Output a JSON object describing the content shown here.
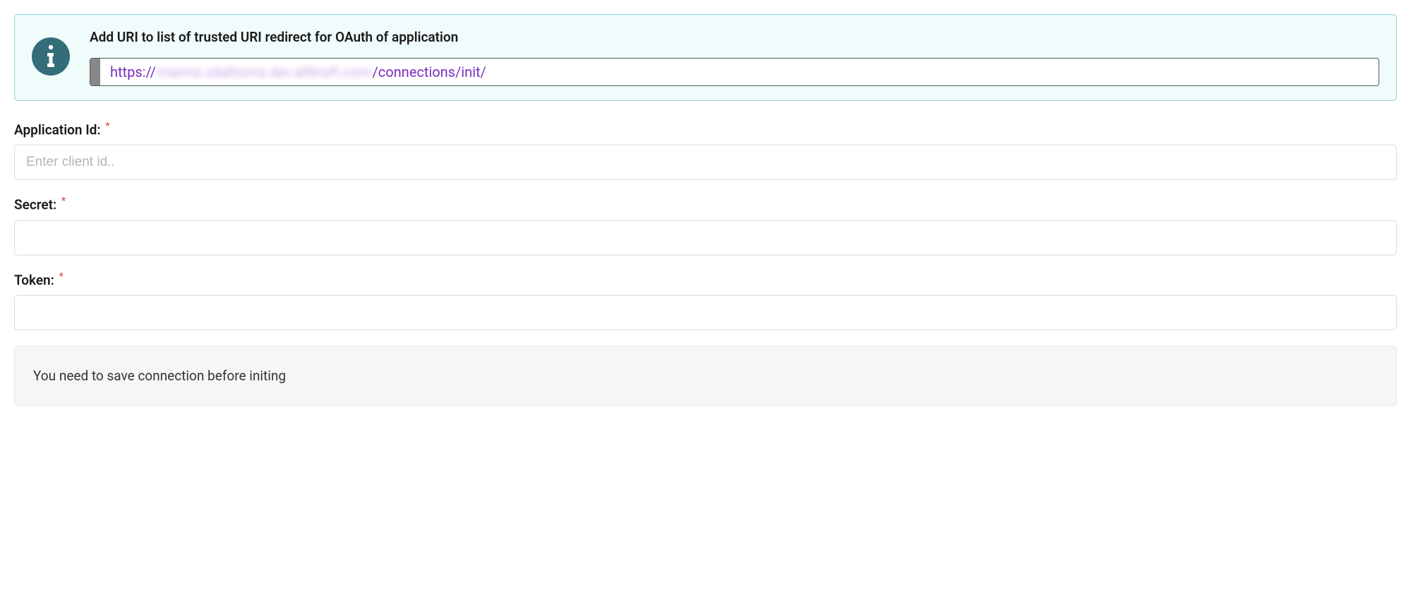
{
  "info": {
    "title": "Add URI to list of trusted URI redirect for OAuth of application",
    "uri_prefix": "https://",
    "uri_blurred": "marina.udaltsova.dev.altkraft.com",
    "uri_suffix": "/connections/init/"
  },
  "fields": {
    "app_id": {
      "label": "Application Id:",
      "placeholder": "Enter client id..",
      "value": ""
    },
    "secret": {
      "label": "Secret:",
      "placeholder": "",
      "value": ""
    },
    "token": {
      "label": "Token:",
      "placeholder": "",
      "value": ""
    }
  },
  "note": {
    "text": "You need to save connection before initing"
  },
  "required_mark": "*"
}
